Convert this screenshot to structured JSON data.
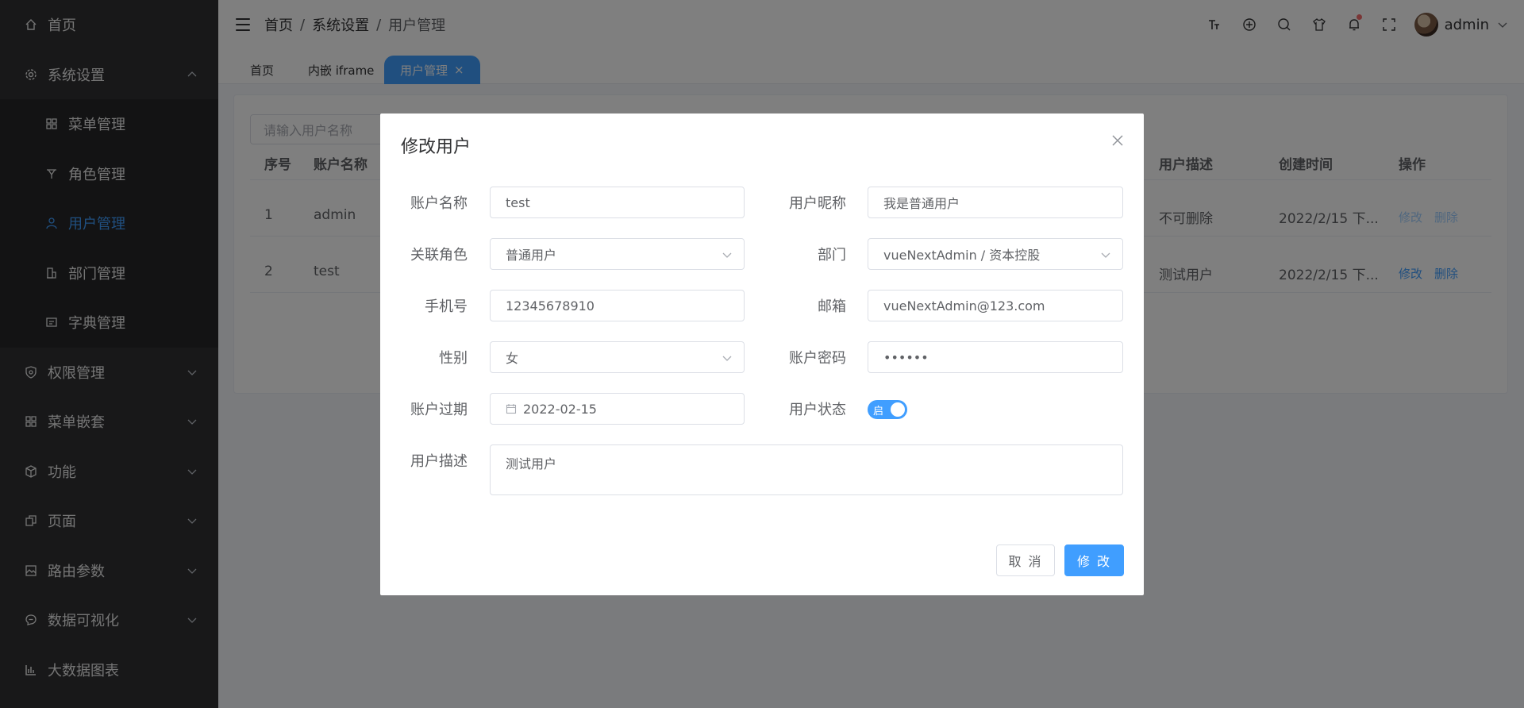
{
  "sidebar": {
    "items": [
      {
        "label": "首页",
        "icon": "home-icon"
      },
      {
        "label": "系统设置",
        "icon": "gear-icon",
        "expanded": true
      },
      {
        "label": "菜单管理",
        "icon": "grid-icon"
      },
      {
        "label": "角色管理",
        "icon": "role-icon"
      },
      {
        "label": "用户管理",
        "icon": "user-icon",
        "active": true
      },
      {
        "label": "部门管理",
        "icon": "office-icon"
      },
      {
        "label": "字典管理",
        "icon": "dictionary-icon"
      },
      {
        "label": "权限管理",
        "icon": "shield-icon"
      },
      {
        "label": "菜单嵌套",
        "icon": "grid-icon"
      },
      {
        "label": "功能",
        "icon": "box-icon"
      },
      {
        "label": "页面",
        "icon": "copy-icon"
      },
      {
        "label": "路由参数",
        "icon": "image-icon"
      },
      {
        "label": "数据可视化",
        "icon": "chat-icon"
      },
      {
        "label": "大数据图表",
        "icon": "bar-chart-icon"
      }
    ]
  },
  "header": {
    "breadcrumb": [
      "首页",
      "系统设置",
      "用户管理"
    ],
    "separator": "/",
    "user_name": "admin"
  },
  "tabs": [
    {
      "label": "首页"
    },
    {
      "label": "内嵌 iframe"
    },
    {
      "label": "用户管理",
      "active": true,
      "close": "×"
    }
  ],
  "list": {
    "search_placeholder": "请输入用户名称",
    "columns": [
      "序号",
      "账户名称",
      "用户描述",
      "创建时间",
      "操作"
    ],
    "rows": [
      {
        "index": "1",
        "account": "admin",
        "desc": "不可删除",
        "created": "2022/2/15 下...",
        "edit": "修改",
        "delete": "删除"
      },
      {
        "index": "2",
        "account": "test",
        "desc": "测试用户",
        "created": "2022/2/15 下...",
        "edit": "修改",
        "delete": "删除"
      }
    ]
  },
  "dialog": {
    "title": "修改用户",
    "fields": {
      "account_label": "账户名称",
      "account_value": "test",
      "nickname_label": "用户昵称",
      "nickname_value": "我是普通用户",
      "role_label": "关联角色",
      "role_value": "普通用户",
      "dept_label": "部门",
      "dept_value": "vueNextAdmin / 资本控股",
      "phone_label": "手机号",
      "phone_value": "12345678910",
      "email_label": "邮箱",
      "email_value": "vueNextAdmin@123.com",
      "gender_label": "性别",
      "gender_value": "女",
      "password_label": "账户密码",
      "password_value": "••••••",
      "expire_label": "账户过期",
      "expire_value": "2022-02-15",
      "status_label": "用户状态",
      "status_text": "启",
      "desc_label": "用户描述",
      "desc_value": "测试用户"
    },
    "cancel_label": "取 消",
    "submit_label": "修 改"
  },
  "colors": {
    "primary": "#409eff",
    "sidebar": "#303133",
    "danger": "#f56c6c"
  }
}
